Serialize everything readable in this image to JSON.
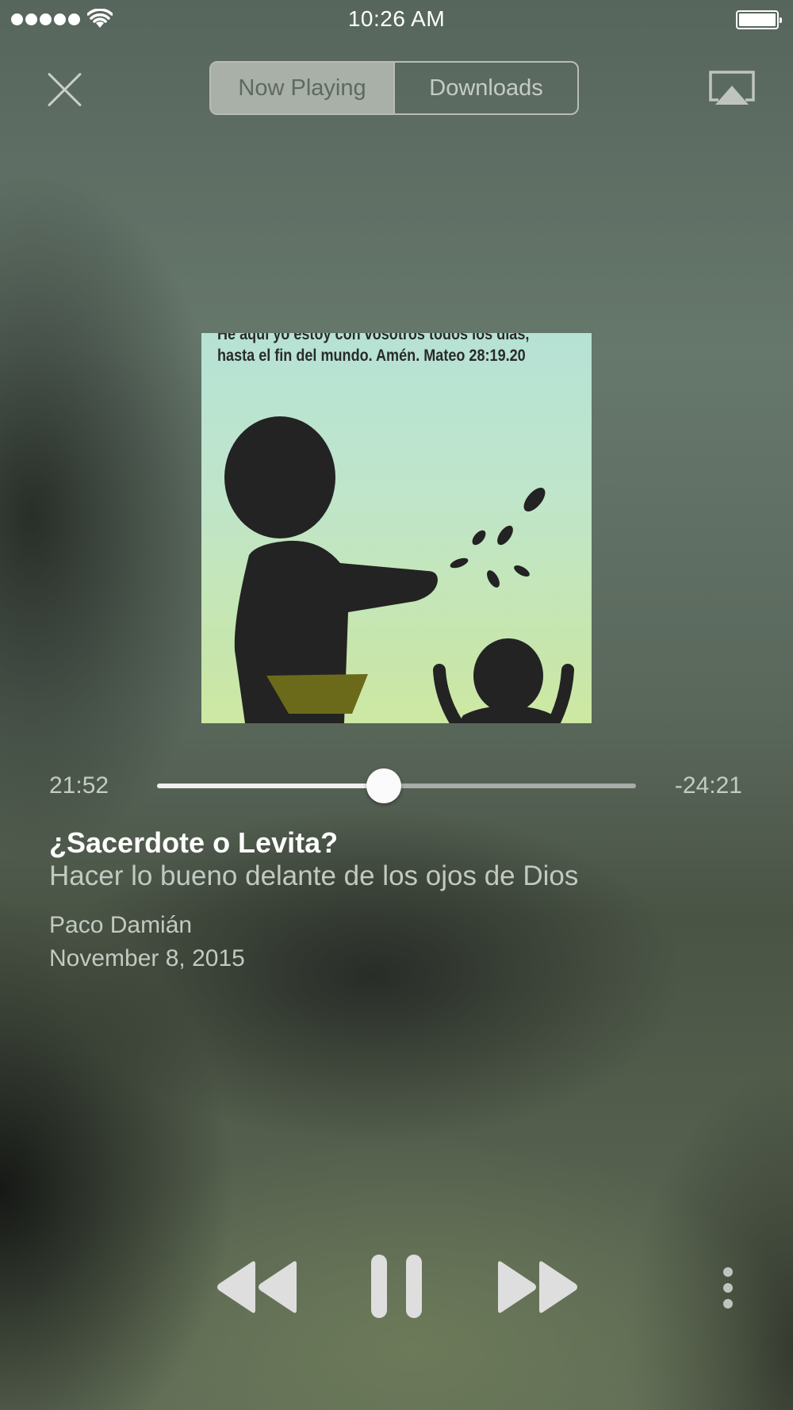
{
  "status_bar": {
    "time": "10:26 AM",
    "signal_bars": 5,
    "wifi_icon": "wifi-icon",
    "battery_level": 1.0
  },
  "header": {
    "close_icon": "close-icon",
    "airplay_icon": "airplay-icon",
    "segments": [
      {
        "label": "Now Playing",
        "selected": true
      },
      {
        "label": "Downloads",
        "selected": false
      }
    ]
  },
  "artwork": {
    "caption_line1": "He aquí yo estoy con vosotros todos los días,",
    "caption_line2": "hasta el fin del mundo. Amén. Mateo 28:19.20",
    "colors": {
      "sky_top": "#b6e2d5",
      "sky_bottom": "#cde8a2",
      "figure": "#222222",
      "basket": "#6b6a1a"
    }
  },
  "player": {
    "elapsed": "21:52",
    "remaining": "-24:21",
    "progress": 0.474
  },
  "track": {
    "title": "¿Sacerdote o Levita?",
    "subtitle": "Hacer lo bueno delante de los ojos de Dios",
    "speaker": "Paco Damián",
    "date": "November 8, 2015"
  },
  "controls": {
    "rewind_icon": "rewind-icon",
    "pause_icon": "pause-icon",
    "forward_icon": "fast-forward-icon",
    "more_icon": "more-vertical-icon"
  }
}
